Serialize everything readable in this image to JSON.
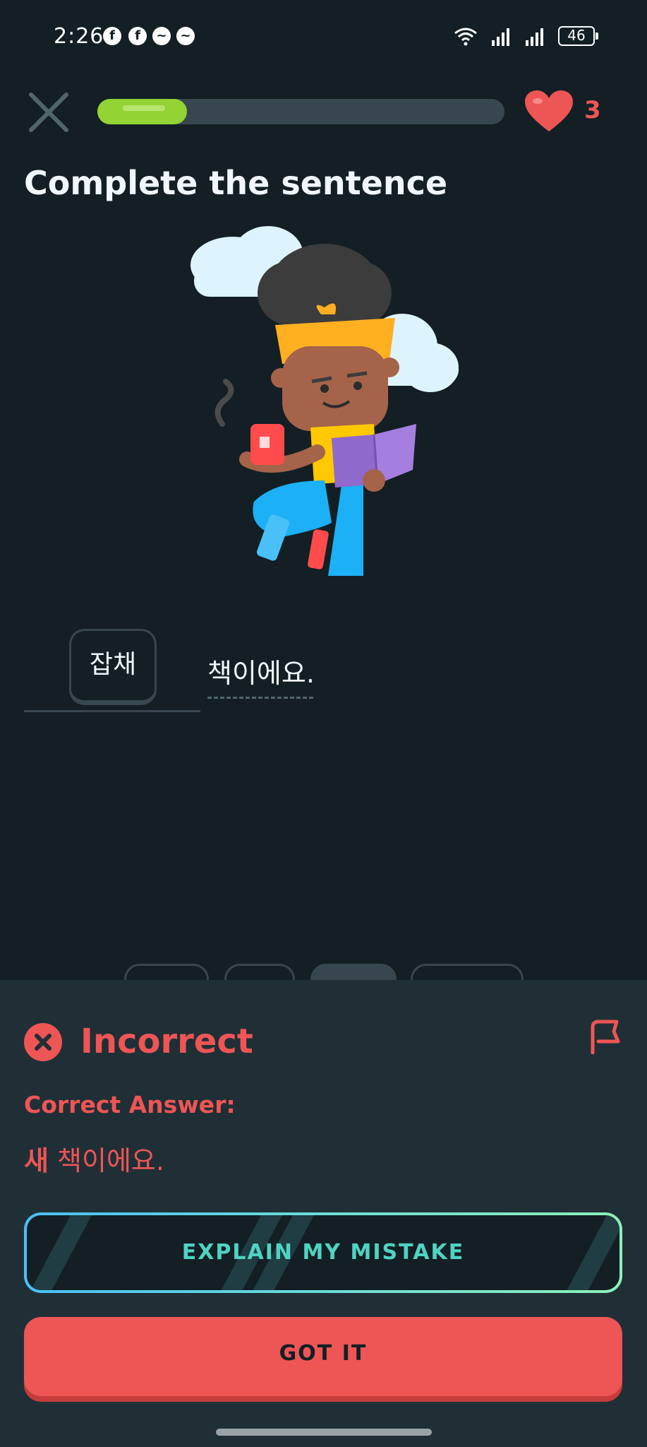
{
  "status_bar": {
    "time": "2:26",
    "notification_icons": [
      "facebook-icon",
      "facebook-icon",
      "messenger-icon",
      "messenger-icon"
    ],
    "battery": "46"
  },
  "lesson": {
    "progress_fraction": 0.22,
    "hearts": "3",
    "prompt_title": "Complete the sentence"
  },
  "sentence": {
    "selected_word": "잡채",
    "rest": "책이에요."
  },
  "feedback": {
    "status": "Incorrect",
    "correct_answer_label": "Correct Answer:",
    "correct_answer_highlight": "새",
    "correct_answer_rest": " 책이에요.",
    "explain_button": "EXPLAIN MY MISTAKE",
    "continue_button": "GOT IT"
  },
  "colors": {
    "background": "#131f24",
    "sheet": "#202f36",
    "error": "#ee5555",
    "progress": "#93d333",
    "explain_accent": "#4fd3c4"
  }
}
